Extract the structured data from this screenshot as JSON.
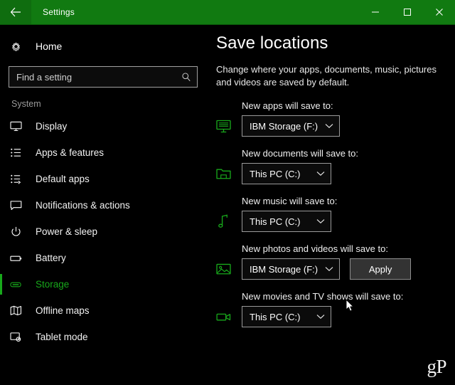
{
  "window": {
    "title": "Settings",
    "back_icon": "back-arrow-icon",
    "minimize_label": "—",
    "maximize_label": "☐",
    "close_label": "✕",
    "titlebar_color": "#117a11"
  },
  "sidebar": {
    "home": {
      "label": "Home",
      "icon": "gear-icon"
    },
    "search": {
      "placeholder": "Find a setting",
      "value": "",
      "icon": "search-icon"
    },
    "group_title": "System",
    "accent_color": "#18a81b",
    "items": [
      {
        "label": "Display",
        "icon": "monitor-icon",
        "selected": false
      },
      {
        "label": "Apps & features",
        "icon": "list-icon",
        "selected": false
      },
      {
        "label": "Default apps",
        "icon": "list-arrow-icon",
        "selected": false
      },
      {
        "label": "Notifications & actions",
        "icon": "speech-bubble-icon",
        "selected": false
      },
      {
        "label": "Power & sleep",
        "icon": "power-icon",
        "selected": false
      },
      {
        "label": "Battery",
        "icon": "battery-icon",
        "selected": false
      },
      {
        "label": "Storage",
        "icon": "storage-icon",
        "selected": true
      },
      {
        "label": "Offline maps",
        "icon": "map-icon",
        "selected": false
      },
      {
        "label": "Tablet mode",
        "icon": "tablet-icon",
        "selected": false
      }
    ]
  },
  "content": {
    "title": "Save locations",
    "description": "Change where your apps, documents, music, pictures and videos are saved by default.",
    "icon_color": "#18a81b",
    "locations": [
      {
        "label": "New apps will save to:",
        "icon": "app-monitor-icon",
        "value": "IBM Storage (F:)",
        "chevron": "chevron-down-icon",
        "has_apply": false
      },
      {
        "label": "New documents will save to:",
        "icon": "folder-icon",
        "value": "This PC (C:)",
        "chevron": "chevron-down-icon",
        "has_apply": false
      },
      {
        "label": "New music will save to:",
        "icon": "music-note-icon",
        "value": "This PC (C:)",
        "chevron": "chevron-down-icon",
        "has_apply": false
      },
      {
        "label": "New photos and videos will save to:",
        "icon": "picture-icon",
        "value": "IBM Storage (F:)",
        "chevron": "chevron-down-icon",
        "has_apply": true,
        "apply_label": "Apply"
      },
      {
        "label": "New movies and TV shows will save to:",
        "icon": "video-camera-icon",
        "value": "This PC (C:)",
        "chevron": "chevron-down-icon",
        "has_apply": false
      }
    ],
    "watermark": "gP"
  }
}
